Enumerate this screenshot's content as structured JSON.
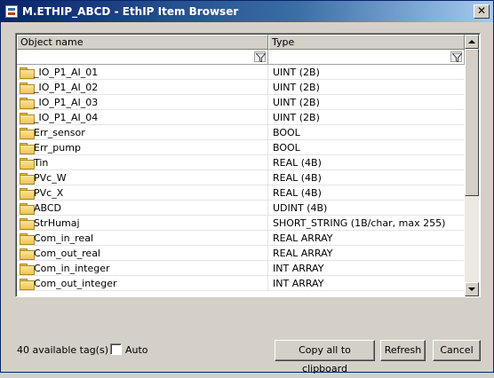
{
  "window": {
    "title": "M.ETHIP_ABCD - EthIP Item Browser",
    "close_glyph": "✕"
  },
  "columns": {
    "name": "Object name",
    "type": "Type"
  },
  "rows": [
    {
      "name": "_IO_P1_AI_01",
      "type": "UINT (2B)"
    },
    {
      "name": "_IO_P1_AI_02",
      "type": "UINT (2B)"
    },
    {
      "name": "_IO_P1_AI_03",
      "type": "UINT (2B)"
    },
    {
      "name": "_IO_P1_AI_04",
      "type": "UINT (2B)"
    },
    {
      "name": "Err_sensor",
      "type": "BOOL"
    },
    {
      "name": "Err_pump",
      "type": "BOOL"
    },
    {
      "name": "Tin",
      "type": "REAL (4B)"
    },
    {
      "name": "PVc_W",
      "type": "REAL (4B)"
    },
    {
      "name": "PVc_X",
      "type": "REAL (4B)"
    },
    {
      "name": "ABCD",
      "type": "UDINT (4B)"
    },
    {
      "name": "StrHumaj",
      "type": "SHORT_STRING (1B/char, max 255)"
    },
    {
      "name": "Com_in_real",
      "type": "REAL ARRAY"
    },
    {
      "name": "Com_out_real",
      "type": "REAL ARRAY"
    },
    {
      "name": "Com_in_integer",
      "type": "INT ARRAY"
    },
    {
      "name": "Com_out_integer",
      "type": "INT ARRAY"
    }
  ],
  "footer": {
    "tag_count": "40 available tag(s)",
    "auto_label": "Auto",
    "auto_checked": false,
    "copy_label": "Copy all to clipboard",
    "refresh_label": "Refresh",
    "cancel_label": "Cancel"
  }
}
